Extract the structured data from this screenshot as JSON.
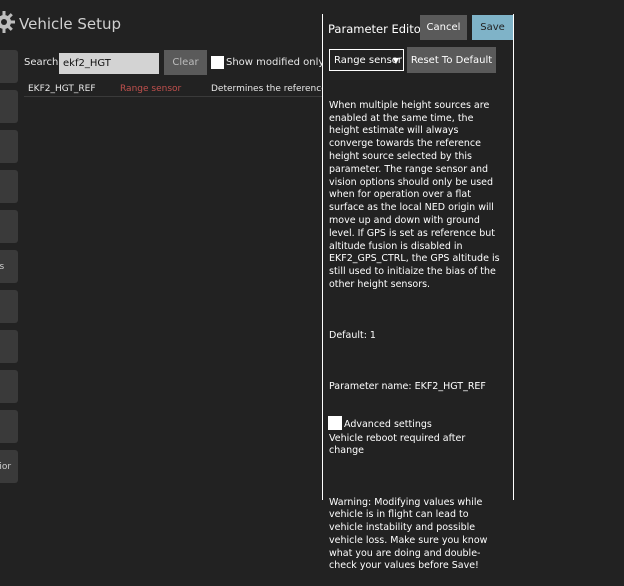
{
  "app": {
    "title": "Vehicle Setup"
  },
  "sidebar": {
    "items": [
      {
        "label": ""
      },
      {
        "label": ""
      },
      {
        "label": ""
      },
      {
        "label": ""
      },
      {
        "label": ""
      },
      {
        "label": "es"
      },
      {
        "label": ""
      },
      {
        "label": ""
      },
      {
        "label": ""
      },
      {
        "label": ""
      },
      {
        "label": "vior"
      }
    ]
  },
  "search": {
    "label": "Search:",
    "value": "ekf2_HGT",
    "clear_label": "Clear",
    "show_modified_label": "Show modified only",
    "show_modified_checked": false
  },
  "table": {
    "rows": [
      {
        "name": "EKF2_HGT_REF",
        "value": "Range sensor",
        "description": "Determines the reference s"
      }
    ]
  },
  "editor": {
    "title": "Parameter Editor",
    "cancel_label": "Cancel",
    "save_label": "Save",
    "selected_value": "Range sensor",
    "reset_label": "Reset To Default",
    "description": "When multiple height sources are enabled at the same time, the height estimate will always converge towards the reference height source selected by this parameter. The range sensor and vision options should only be used when for operation over a flat surface as the local NED origin will move up and down with ground level. If GPS is set as reference but altitude fusion is disabled in EKF2_GPS_CTRL, the GPS altitude is still used to initiaize the bias of the other height sensors.",
    "default_text": "Default: 1",
    "param_name_text": "Parameter name: EKF2_HGT_REF",
    "reboot_text": "Vehicle reboot required after change",
    "warning_text": "Warning: Modifying values while vehicle is in flight can lead to vehicle instability and possible vehicle loss. Make sure you know what you are doing and double-check your values before Save!",
    "advanced_label": "Advanced settings",
    "advanced_checked": false
  },
  "colors": {
    "background": "#222222",
    "button": "#5a5a5a",
    "save_button": "#7fb3c8",
    "param_value": "#c0504d"
  },
  "icons": {
    "header": "gear-icon",
    "dropdown": "caret-down-icon"
  }
}
